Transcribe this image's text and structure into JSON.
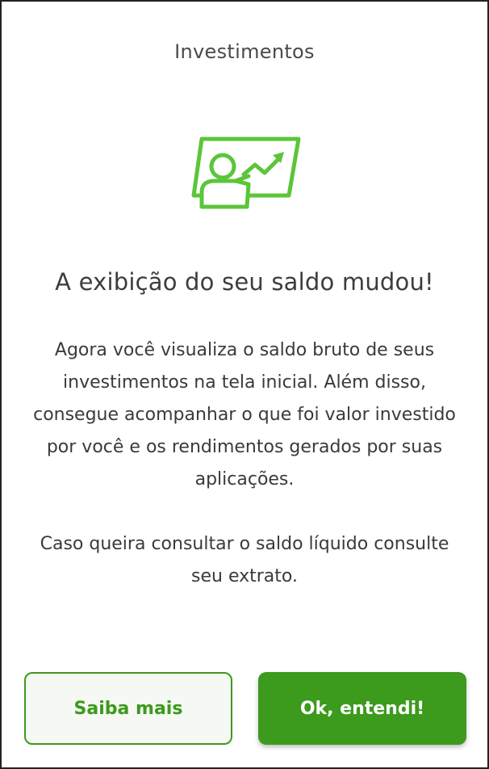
{
  "header": {
    "title": "Investimentos"
  },
  "hero": {
    "icon": "investment-presentation-chart-icon",
    "accent_color": "#5cc53a"
  },
  "content": {
    "headline": "A exibição do seu saldo mudou!",
    "paragraph_1": "Agora você visualiza o saldo bruto de seus investimentos na tela inicial. Além disso, consegue acompanhar o que foi valor investido por você e os rendimentos gerados por suas aplicações.",
    "paragraph_2": "Caso queira consultar o saldo líquido consulte seu extrato."
  },
  "actions": {
    "secondary_label": "Saiba mais",
    "primary_label": "Ok, entendi!",
    "primary_color": "#3c9a1c"
  }
}
